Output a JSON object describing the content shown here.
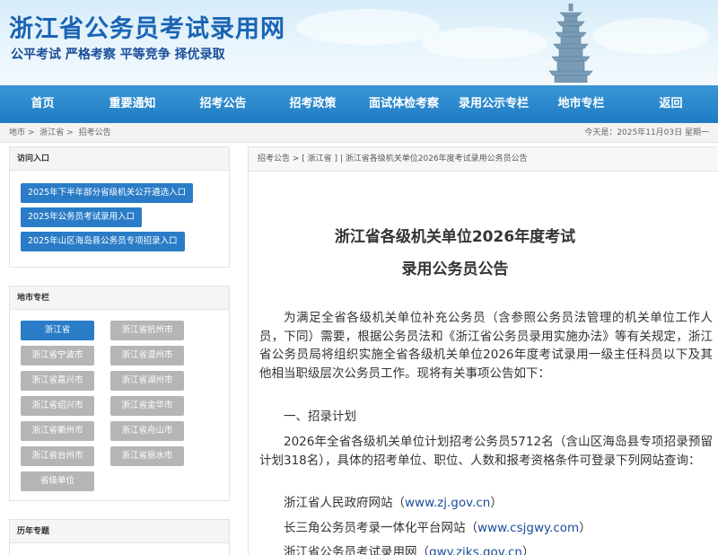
{
  "header": {
    "site_title": "浙江省公务员考试录用网",
    "slogan": "公平考试  严格考察  平等竞争  择优录取"
  },
  "nav": {
    "items": [
      "首页",
      "重要通知",
      "招考公告",
      "招考政策",
      "面试体检考察",
      "录用公示专栏",
      "地市专栏",
      "返回"
    ]
  },
  "breadcrumb": {
    "items": [
      "地市 >",
      "浙江省 >",
      "招考公告"
    ],
    "date": "今天是：2025年11月03日 星期一"
  },
  "sidebar": {
    "access": {
      "title": "访问入口",
      "entries": [
        "2025年下半年部分省级机关公开遴选入口",
        "2025年公务员考试录用入口",
        "2025年山区海岛县公务员专项招录入口"
      ]
    },
    "cities": {
      "title": "地市专栏",
      "items": [
        "浙江省",
        "浙江省杭州市",
        "浙江省宁波市",
        "浙江省温州市",
        "浙江省嘉兴市",
        "浙江省湖州市",
        "浙江省绍兴市",
        "浙江省金华市",
        "浙江省衢州市",
        "浙江省舟山市",
        "浙江省台州市",
        "浙江省丽水市",
        "省级单位"
      ]
    },
    "history": {
      "title": "历年专题"
    }
  },
  "article": {
    "crumb": "招考公告 > [ 浙江省 ] | 浙江省各级机关单位2026年度考试录用公务员公告",
    "title_line1": "浙江省各级机关单位2026年度考试",
    "title_line2": "录用公务员公告",
    "para1": "为满足全省各级机关单位补充公务员（含参照公务员法管理的机关单位工作人员，下同）需要，根据公务员法和《浙江省公务员录用实施办法》等有关规定，浙江省公务员局将组织实施全省各级机关单位2026年度考试录用一级主任科员以下及其他相当职级层次公务员工作。现将有关事项公告如下：",
    "section1": "一、招录计划",
    "para2": "2026年全省各级机关单位计划招考公务员5712名（含山区海岛县专项招录预留计划318名），具体的招考单位、职位、人数和报考资格条件可登录下列网站查询：",
    "links": [
      {
        "name": "浙江省人民政府网站（",
        "url": "www.zj.gov.cn",
        "end": "）"
      },
      {
        "name": "长三角公务员考录一体化平台网站（",
        "url": "www.csjgwy.com",
        "end": "）"
      },
      {
        "name": "浙江省公务员考试录用网（",
        "url": "gwy.zjks.gov.cn",
        "end": "）"
      }
    ]
  },
  "colors": {
    "nav_blue": "#1f7cc4",
    "button_blue": "#2a7cc7",
    "button_gray": "#b5b5b5",
    "title_blue": "#1a64b4"
  }
}
